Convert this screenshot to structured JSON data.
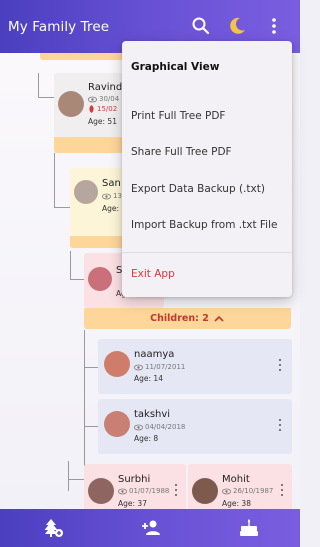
{
  "appbar": {
    "title": "My Family Tree",
    "icons": [
      "search-icon",
      "moon-icon",
      "more-vert-icon"
    ]
  },
  "menu": {
    "items": [
      {
        "label": "Graphical View"
      },
      {
        "label": "Print Full Tree PDF"
      },
      {
        "label": "Share Full Tree PDF"
      },
      {
        "label": "Export Data Backup (.txt)"
      },
      {
        "label": "Import Backup from .txt File"
      },
      {
        "label": "Exit App"
      }
    ]
  },
  "tree": {
    "ravind": {
      "name": "Ravind",
      "dob": "30/04",
      "dod": "15/02",
      "age": "Age: 51"
    },
    "san": {
      "name": "San",
      "dob": "13",
      "age": "Age:"
    },
    "s": {
      "name": "S",
      "dob": "",
      "age": "Age"
    },
    "children_bar": "Children: 2",
    "naamya": {
      "name": "naamya",
      "dob": "11/07/2011",
      "age": "Age: 14"
    },
    "takshvi": {
      "name": "takshvi",
      "dob": "04/04/2018",
      "age": "Age: 8"
    },
    "surbhi": {
      "name": "Surbhi",
      "dob": "01/07/1988",
      "age": "Age: 37"
    },
    "mohit": {
      "name": "Mohit",
      "dob": "26/10/1987",
      "age": "Age: 38"
    }
  },
  "bottomnav": {
    "icons": [
      "tree-add-icon",
      "add-person-icon",
      "cake-icon"
    ]
  },
  "colors": {
    "primary": "#5a48cc",
    "card_blue": "#e6e7f5",
    "card_pink": "#fbe0e4",
    "card_cream": "#fdf5d8",
    "children_bar": "#ffd699",
    "danger": "#d43a3a"
  }
}
